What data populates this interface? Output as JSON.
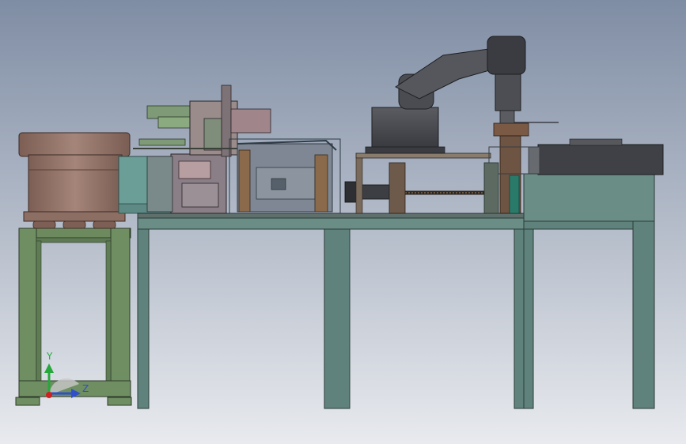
{
  "viewport": {
    "name": "3d-cad-viewport",
    "background_top": "#7f8da4",
    "background_bottom": "#e8eaee"
  },
  "colors": {
    "frame_green": "#5d7e76",
    "frame_dark": "#2f3f3c",
    "table_top": "#6c7a76",
    "bowl_brown": "#9a7a6f",
    "robot_gray": "#4a4c52",
    "enclosure_dark": "#3d3f43",
    "cyan_block": "#6a9e97",
    "copper": "#8a6a4a",
    "olive_frame": "#7a9670"
  },
  "triad": {
    "y_label": "Y",
    "z_label": "Z",
    "y_color": "#27a83d",
    "z_color": "#2f50c8",
    "x_color": "#d02020"
  },
  "components": {
    "vibratory_bowl": "vibratory-bowl-feeder",
    "feeder_stand": "feeder-stand",
    "main_table": "main-workbench",
    "scara_robot": "six-axis-robot-arm",
    "enclosure": "control-enclosure",
    "assembly_station": "assembly-station",
    "linear_module": "ball-screw-linear-module"
  }
}
